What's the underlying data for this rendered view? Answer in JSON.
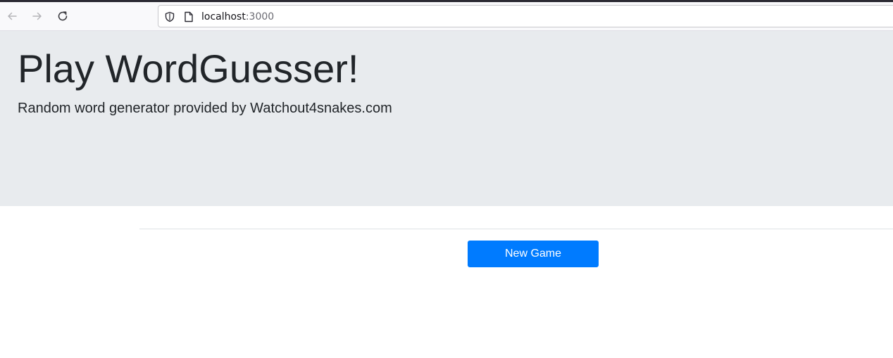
{
  "browser": {
    "url_host": "localhost",
    "url_port": ":3000",
    "icons": {
      "back": "arrow-left-icon",
      "forward": "arrow-right-icon",
      "reload": "reload-icon",
      "tracking": "shield-icon",
      "page": "page-icon"
    }
  },
  "jumbotron": {
    "title": "Play WordGuesser!",
    "subtitle": "Random word generator provided by Watchout4snakes.com",
    "background": "#e8ebee"
  },
  "main": {
    "new_game_label": "New Game",
    "button_color": "#007bff"
  }
}
